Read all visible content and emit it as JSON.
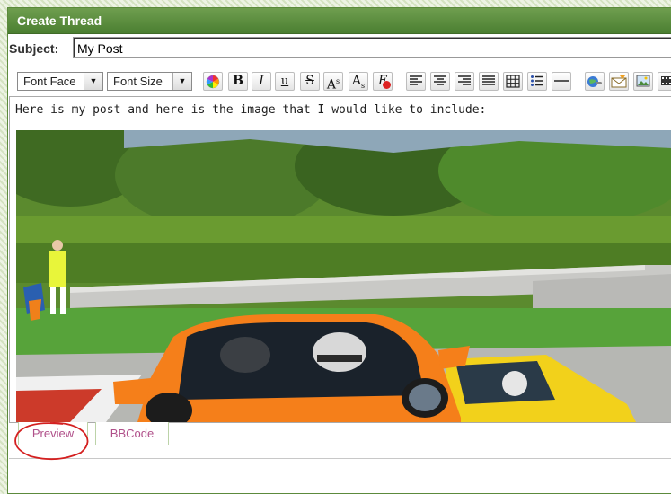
{
  "panel": {
    "title": "Create Thread"
  },
  "subject": {
    "label": "Subject:",
    "value": "My Post"
  },
  "toolbar": {
    "font_face": "Font Face",
    "font_size": "Font Size",
    "buttons": [
      {
        "icon": "color-wheel-icon"
      },
      {
        "icon": "bold-icon",
        "glyph": "B"
      },
      {
        "icon": "italic-icon",
        "glyph": "I"
      },
      {
        "icon": "underline-icon",
        "glyph": "u"
      },
      {
        "icon": "strikethrough-icon",
        "glyph": "S"
      },
      {
        "icon": "superscript-icon",
        "glyph": "A",
        "sup": "s"
      },
      {
        "icon": "subscript-icon",
        "glyph": "A",
        "sub": "s"
      },
      {
        "icon": "remove-format-icon",
        "glyph": "F"
      },
      {
        "icon": "align-left-icon"
      },
      {
        "icon": "align-center-icon"
      },
      {
        "icon": "align-right-icon"
      },
      {
        "icon": "justify-icon"
      },
      {
        "icon": "table-icon"
      },
      {
        "icon": "bullet-list-icon"
      },
      {
        "icon": "horizontal-rule-icon"
      },
      {
        "icon": "insert-link-icon"
      },
      {
        "icon": "insert-email-icon"
      },
      {
        "icon": "insert-image-icon"
      },
      {
        "icon": "insert-video-icon"
      }
    ]
  },
  "editor": {
    "text": "Here is my post and here is the image that I would like to include:"
  },
  "tabs": {
    "preview": "Preview",
    "bbcode": "BBCode"
  },
  "colors": {
    "header_green": "#4b7f31",
    "tab_text": "#b0508a",
    "annotation": "#d42020"
  }
}
